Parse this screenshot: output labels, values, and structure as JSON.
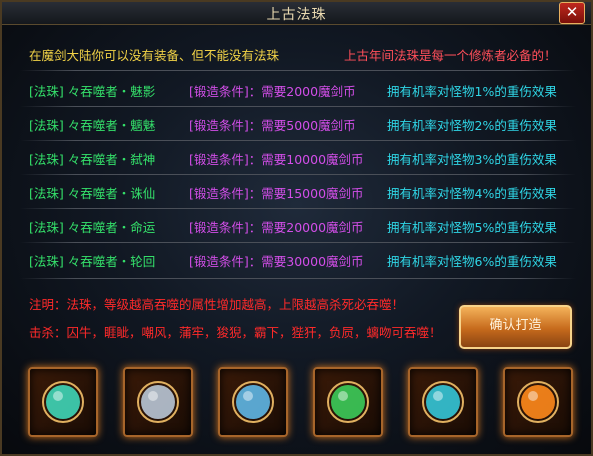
{
  "window": {
    "title": "上古法珠",
    "close_label": "✕"
  },
  "intro": {
    "left": "在魔剑大陆你可以没有装备、但不能没有法珠",
    "right": "上古年间法珠是每一个修炼者必备的！"
  },
  "rows": [
    {
      "name": "[法珠] 々吞噬者・魅影",
      "cond": "[锻造条件]：需要2000魔剑币",
      "effect": "拥有机率对怪物1%的重伤效果"
    },
    {
      "name": "[法珠] 々吞噬者・魑魅",
      "cond": "[锻造条件]：需要5000魔剑币",
      "effect": "拥有机率对怪物2%的重伤效果"
    },
    {
      "name": "[法珠] 々吞噬者・弑神",
      "cond": "[锻造条件]：需要10000魔剑币",
      "effect": "拥有机率对怪物3%的重伤效果"
    },
    {
      "name": "[法珠] 々吞噬者・诛仙",
      "cond": "[锻造条件]：需要15000魔剑币",
      "effect": "拥有机率对怪物4%的重伤效果"
    },
    {
      "name": "[法珠] 々吞噬者・命运",
      "cond": "[锻造条件]：需要20000魔剑币",
      "effect": "拥有机率对怪物5%的重伤效果"
    },
    {
      "name": "[法珠] 々吞噬者・轮回",
      "cond": "[锻造条件]：需要30000魔剑币",
      "effect": "拥有机率对怪物6%的重伤效果"
    }
  ],
  "note": {
    "label": "注明：",
    "text": "法珠，等级越高吞噬的属性增加越高，上限越高杀死必吞噬！"
  },
  "kill": {
    "label": "击杀：",
    "text": "囚牛，睚眦，嘲风，蒲牢，狻猊，霸下，狴犴，负屃，螭吻可吞噬！"
  },
  "confirm_button": "确认打造",
  "slots": [
    {
      "icon": "teal-orb-icon",
      "color": "#3fd6b8"
    },
    {
      "icon": "silver-orb-icon",
      "color": "#b9c7d6"
    },
    {
      "icon": "blue-orb-icon",
      "color": "#5fb7e6"
    },
    {
      "icon": "green-orb-icon",
      "color": "#3ccc5a"
    },
    {
      "icon": "cyan-orb-icon",
      "color": "#34c7d8"
    },
    {
      "icon": "orange-orb-icon",
      "color": "#ff8a1c"
    }
  ]
}
